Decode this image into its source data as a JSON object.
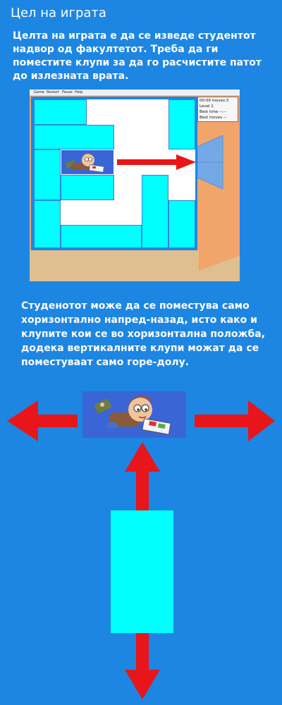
{
  "heading": "Цел на играта",
  "intro": "Целта на играта е да се изведе студентот надвор од факултетот. Треба да ги поместите клупи за да го расчистите патот до излезната врата.",
  "game": {
    "menu": [
      "Game",
      "Restart",
      "Pause",
      "Help"
    ],
    "hud": {
      "time": "00:09",
      "moves": "moves:3",
      "level": "Level 1",
      "best_time": "Best time --:--",
      "best_moves": "Best moves --"
    }
  },
  "instructions": "Студенотот може да се поместува само хоризонтално напред-назад, исто како и клупите кои се во хоризонтална положба, додека вертикалните клупи можат да се поместуваат само горе-долу.",
  "colors": {
    "background": "#1d85e2",
    "bench": "#00ffff",
    "arrow": "#e8161b",
    "student_tile": "#3965d7",
    "wall": "#f1a56b",
    "floor": "#dfbe8f"
  },
  "icons": [
    "student-reading-icon",
    "arrow-left-icon",
    "arrow-right-icon",
    "arrow-up-icon",
    "arrow-down-icon",
    "exit-door-icon"
  ]
}
